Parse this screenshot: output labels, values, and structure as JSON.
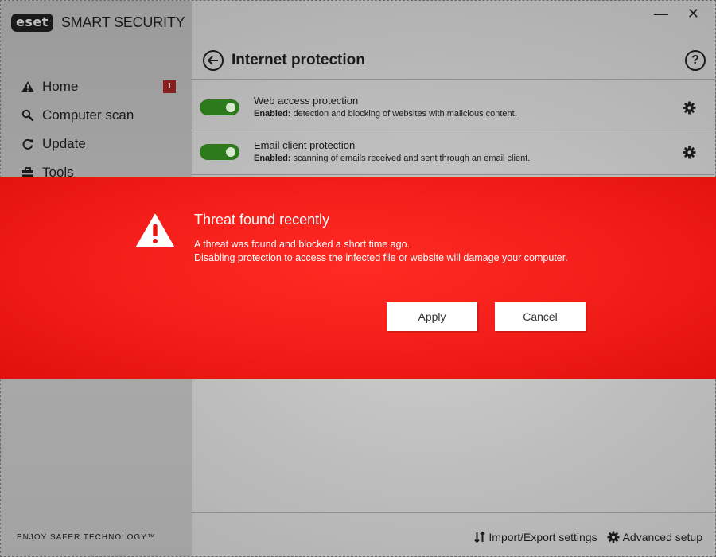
{
  "app": {
    "logo_text": "eset",
    "product_name": "SMART SECURITY",
    "tagline": "ENJOY SAFER TECHNOLOGY™"
  },
  "window_controls": {
    "minimize": "—",
    "close": "✕"
  },
  "sidebar": {
    "items": [
      {
        "label": "Home",
        "icon": "warning-icon",
        "badge": "1"
      },
      {
        "label": "Computer scan",
        "icon": "search-icon"
      },
      {
        "label": "Update",
        "icon": "refresh-icon"
      },
      {
        "label": "Tools",
        "icon": "toolbox-icon"
      }
    ]
  },
  "page": {
    "title": "Internet protection",
    "help": "?",
    "rows": [
      {
        "name": "Web access protection",
        "status_label": "Enabled:",
        "status_text": " detection and blocking of websites with malicious content.",
        "enabled": true
      },
      {
        "name": "Email client protection",
        "status_label": "Enabled:",
        "status_text": " scanning of emails received and sent through an email client.",
        "enabled": true
      }
    ]
  },
  "footer": {
    "import_export": "Import/Export settings",
    "advanced_setup": "Advanced setup"
  },
  "alert": {
    "title": "Threat found recently",
    "message": "A threat was found and blocked a short time ago.\nDisabling protection to access the infected file or website will damage your computer.",
    "apply_label": "Apply",
    "cancel_label": "Cancel"
  },
  "colors": {
    "alert_red": "#f5201b",
    "toggle_green": "#2d7a1c",
    "badge_red": "#8a1d1d"
  }
}
